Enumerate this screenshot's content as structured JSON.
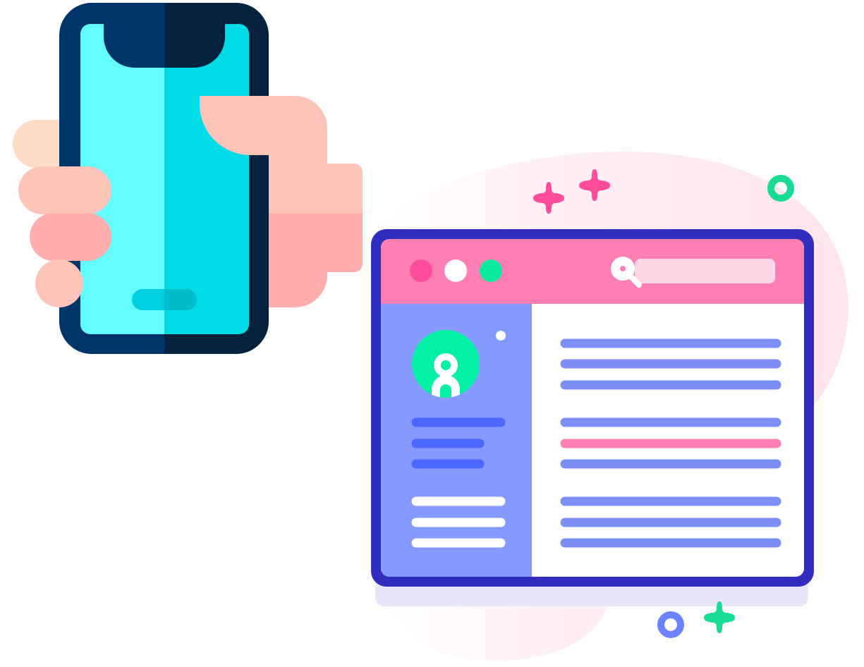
{
  "illustration": {
    "phone": {
      "icon": "smartphone-icon",
      "colors": {
        "frame_light": "#00356A",
        "frame_dark": "#04213D",
        "screen_light": "#63FCFF",
        "screen_dark": "#00DCE6",
        "home_bar": "#00CFE0"
      }
    },
    "hand": {
      "icon": "hand-icon",
      "colors": {
        "skin": "#FEC4B9",
        "skin_shadow": "#FFADAD",
        "thumb_tip": "#FFDCC7"
      }
    },
    "browser_window": {
      "icon": "browser-window-icon",
      "colors": {
        "border": "#2F2CBE",
        "header": "#FF7FB3",
        "sidebar": "#8599FF",
        "content": "#FFFFFF",
        "dot_pink": "#FF4D99",
        "dot_white": "#FFFFFF",
        "dot_green": "#0BEB9F",
        "search_field": "#FFD6E6",
        "avatar_bg": "#00F0A6",
        "sidebar_line_dark": "#4A67FF",
        "content_line": "#7E8FF2",
        "content_line_highlight": "#FF7FB3"
      }
    },
    "decorations": {
      "blob_color": "#FFE3EF",
      "sparkle_pink": "#FF4D99",
      "sparkle_green": "#1ADB93",
      "ring_green": "#1ADB93",
      "ring_blue": "#6C83FF"
    }
  }
}
